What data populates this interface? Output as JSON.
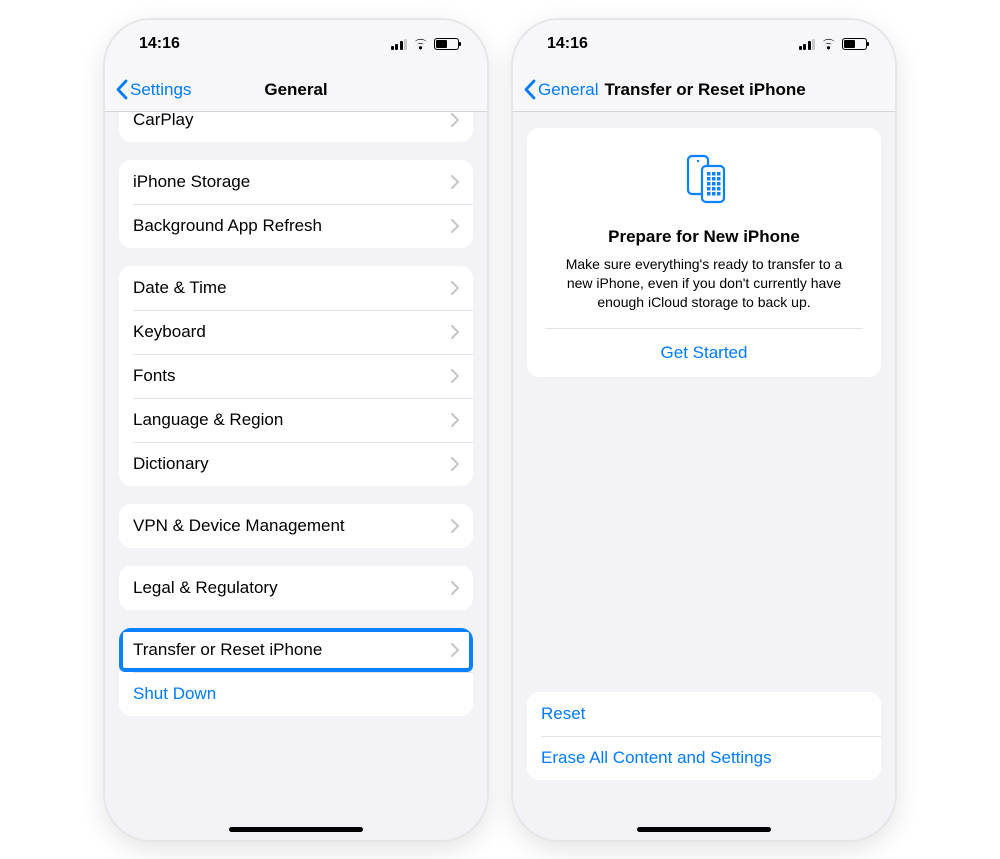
{
  "statusbar": {
    "time": "14:16"
  },
  "left": {
    "back": "Settings",
    "title": "General",
    "rows": {
      "carplay": "CarPlay",
      "storage": "iPhone Storage",
      "refresh": "Background App Refresh",
      "datetime": "Date & Time",
      "keyboard": "Keyboard",
      "fonts": "Fonts",
      "language": "Language & Region",
      "dictionary": "Dictionary",
      "vpn": "VPN & Device Management",
      "legal": "Legal & Regulatory",
      "transfer": "Transfer or Reset iPhone",
      "shutdown": "Shut Down"
    }
  },
  "right": {
    "back": "General",
    "title": "Transfer or Reset iPhone",
    "card": {
      "heading": "Prepare for New iPhone",
      "body": "Make sure everything's ready to transfer to a new iPhone, even if you don't currently have enough iCloud storage to back up.",
      "cta": "Get Started"
    },
    "bottom": {
      "reset": "Reset",
      "erase": "Erase All Content and Settings"
    }
  }
}
